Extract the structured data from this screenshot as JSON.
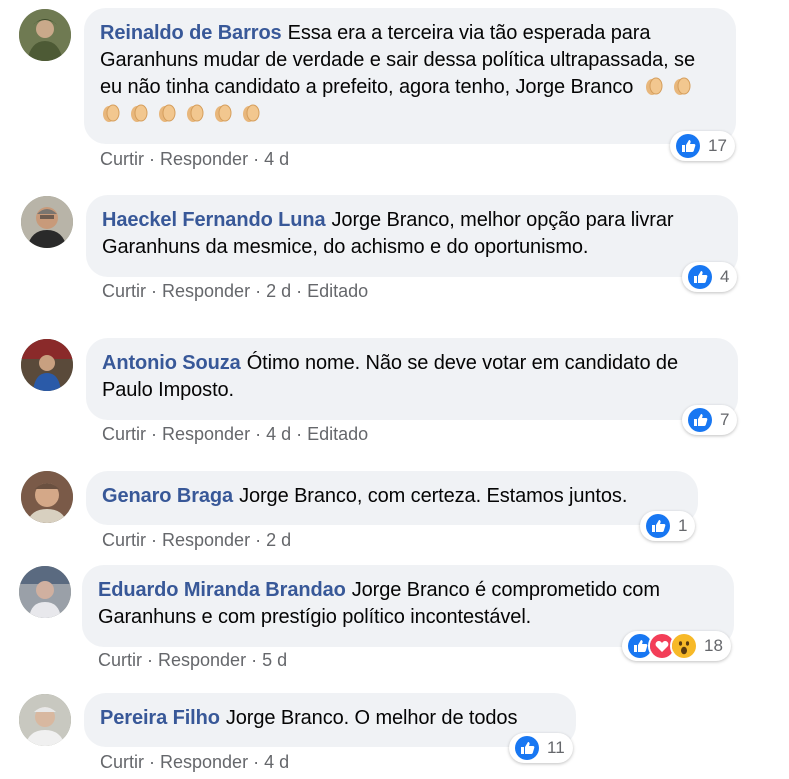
{
  "colors": {
    "author": "#385898",
    "bubble": "#f0f2f5",
    "muted": "#65676b",
    "like": "#1877f2"
  },
  "comments": [
    {
      "author": "Reinaldo de Barros",
      "text": "Essa era a terceira via tão esperada para Garanhuns mudar de verdade e sair dessa política ultrapassada, se eu não tinha candidato a prefeito, agora tenho, Jorge Branco",
      "emojis": [
        "clapping-hands",
        "clapping-hands",
        "clapping-hands",
        "clapping-hands",
        "clapping-hands",
        "clapping-hands",
        "clapping-hands",
        "clapping-hands"
      ],
      "actions": {
        "like": "Curtir",
        "reply": "Responder",
        "time": "4 d",
        "edited": ""
      },
      "reactions": {
        "icons": [
          "like-icon"
        ],
        "count": "17"
      }
    },
    {
      "author": "Haeckel Fernando Luna",
      "text": "Jorge Branco, melhor opção para livrar Garanhuns da mesmice, do achismo e do oportunismo.",
      "actions": {
        "like": "Curtir",
        "reply": "Responder",
        "time": "2 d",
        "edited": "Editado"
      },
      "reactions": {
        "icons": [
          "like-icon"
        ],
        "count": "4"
      }
    },
    {
      "author": "Antonio Souza",
      "text": "Ótimo nome. Não se deve votar em candidato de Paulo Imposto.",
      "actions": {
        "like": "Curtir",
        "reply": "Responder",
        "time": "4 d",
        "edited": "Editado"
      },
      "reactions": {
        "icons": [
          "like-icon"
        ],
        "count": "7"
      }
    },
    {
      "author": "Genaro Braga",
      "text": "Jorge Branco, com certeza. Estamos juntos.",
      "actions": {
        "like": "Curtir",
        "reply": "Responder",
        "time": "2 d",
        "edited": ""
      },
      "reactions": {
        "icons": [
          "like-icon"
        ],
        "count": "1"
      }
    },
    {
      "author": "Eduardo Miranda Brandao",
      "text": "Jorge Branco é comprometido com Garanhuns e com prestígio político incontestável.",
      "actions": {
        "like": "Curtir",
        "reply": "Responder",
        "time": "5 d",
        "edited": ""
      },
      "reactions": {
        "icons": [
          "like-icon",
          "love-icon",
          "wow-icon"
        ],
        "count": "18"
      }
    },
    {
      "author": "Pereira Filho",
      "text": "Jorge Branco. O melhor de todos",
      "actions": {
        "like": "Curtir",
        "reply": "Responder",
        "time": "4 d",
        "edited": ""
      },
      "reactions": {
        "icons": [
          "like-icon"
        ],
        "count": "11"
      }
    }
  ]
}
